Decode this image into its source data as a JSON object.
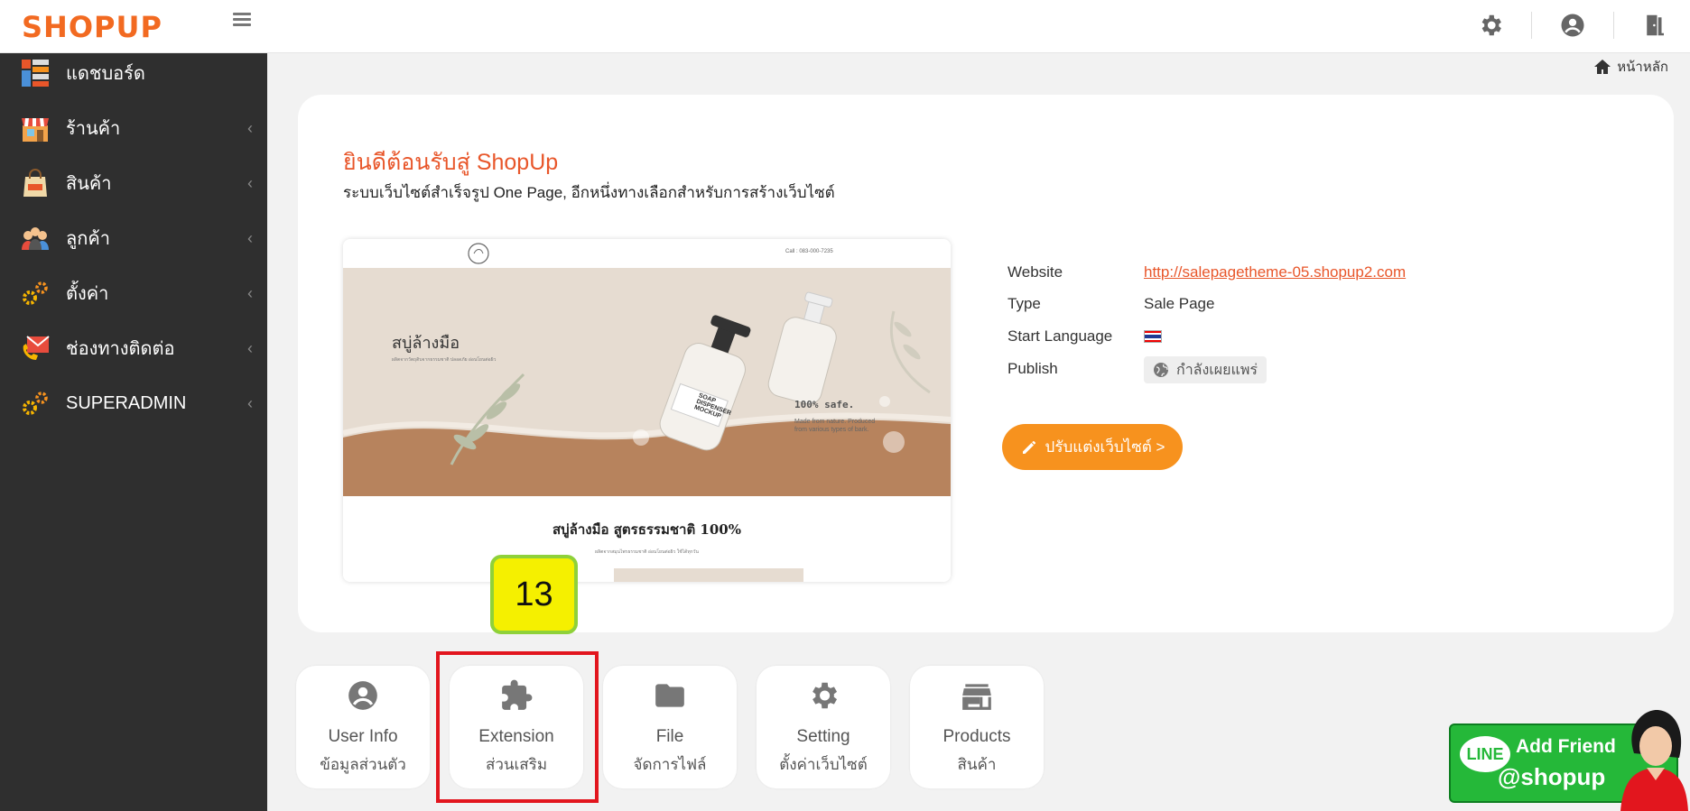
{
  "brand": {
    "logo": "SHOPUP"
  },
  "sidebar": {
    "items": [
      {
        "label": "แดชบอร์ด",
        "icon": "dashboard-icon"
      },
      {
        "label": "ร้านค้า",
        "icon": "store-icon"
      },
      {
        "label": "สินค้า",
        "icon": "shopping-bag-icon"
      },
      {
        "label": "ลูกค้า",
        "icon": "customers-icon"
      },
      {
        "label": "ตั้งค่า",
        "icon": "gears-icon"
      },
      {
        "label": "ช่องทางติดต่อ",
        "icon": "contact-mail-icon"
      },
      {
        "label": "SUPERADMIN",
        "icon": "gears-icon"
      }
    ]
  },
  "breadcrumb": {
    "home": "หน้าหลัก"
  },
  "welcome": {
    "title": "ยินดีต้อนรับสู่ ShopUp",
    "subtitle": "ระบบเว็บไซต์สำเร็จรูป One Page, อีกหนึ่งทางเลือกสำหรับการสร้างเว็บไซต์"
  },
  "preview": {
    "phone": "Call : 083-000-7235",
    "hero_title": "สบู่ล้างมือ",
    "hero_desc": "ผลิตจากวัตถุดิบจากธรรมชาติ ปลอดภัย อ่อนโยนต่อผิว",
    "bottle_label": "SOAP DISPENSER MOCKUP",
    "safe": "100% safe.",
    "safe_desc": "Made from nature. Produced from various types of bark.",
    "section_title": "สบู่ล้างมือ สูตรธรรมชาติ 100%",
    "section_desc": "ผลิตจากสมุนไพรธรรมชาติ อ่อนโยนต่อผิว ใช้ได้ทุกวัน"
  },
  "site_info": {
    "website_label": "Website",
    "website_value": "http://salepagetheme-05.shopup2.com",
    "type_label": "Type",
    "type_value": "Sale Page",
    "language_label": "Start Language",
    "language_value": "th-flag",
    "publish_label": "Publish",
    "publish_value": "กำลังเผยแพร่"
  },
  "customize_button": "ปรับแต่งเว็บไซต์ >",
  "step_marker": "13",
  "tiles": [
    {
      "title": "User Info",
      "subtitle": "ข้อมูลส่วนตัว",
      "icon": "user-circle-icon"
    },
    {
      "title": "Extension",
      "subtitle": "ส่วนเสริม",
      "icon": "puzzle-icon"
    },
    {
      "title": "File",
      "subtitle": "จัดการไฟล์",
      "icon": "folder-icon"
    },
    {
      "title": "Setting",
      "subtitle": "ตั้งค่าเว็บไซต์",
      "icon": "gear-icon"
    },
    {
      "title": "Products",
      "subtitle": "สินค้า",
      "icon": "store-icon"
    }
  ],
  "line_banner": {
    "badge": "LINE",
    "line1": "Add Friend",
    "line2": "@shopup"
  },
  "colors": {
    "accent": "#e8562a",
    "button": "#f7921e",
    "sidebar": "#2f2f2f",
    "highlight": "#e2161e",
    "marker": "#f5f000"
  }
}
